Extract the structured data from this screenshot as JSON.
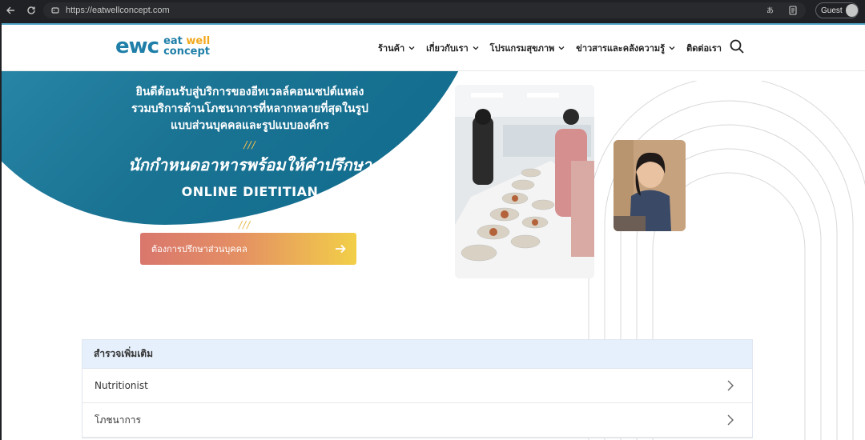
{
  "browser": {
    "url": "https://eatwellconcept.com",
    "profile_label": "Guest",
    "right_icon_1": "translate-icon",
    "right_icon_2": "reader-icon"
  },
  "header": {
    "logo_mark": "ewc",
    "logo_word_1": "eat",
    "logo_word_2": "well",
    "logo_word_3": "concept",
    "menu": [
      {
        "label": "ร้านค้า"
      },
      {
        "label": "เกี่ยวกับเรา"
      },
      {
        "label": "โปรแกรมสุขภาพ"
      },
      {
        "label": "ข่าวสารและคลังความรู้"
      },
      {
        "label": "ติดต่อเรา"
      }
    ]
  },
  "hero": {
    "line1": "ยินดีต้อนรับสู่บริการของอีทเวลล์คอนเซปต์แหล่ง",
    "line2": "รวมบริการด้านโภชนาการที่หลากหลายที่สุดในรูป",
    "line3": "แบบส่วนบุคคลและรูปแบบองค์กร",
    "slashes": "///",
    "big": "นักกำหนดอาหารพร้อมให้คำปรึกษา",
    "sub": "ONLINE DIETITIAN",
    "cta_label": "ต้องการปรึกษาส่วนบุคคล"
  },
  "explore": {
    "title": "สำรวจเพิ่มเติม",
    "rows": [
      {
        "label": "Nutritionist"
      },
      {
        "label": "โภชนาการ"
      }
    ]
  },
  "colors": {
    "brand_teal": "#1a7393",
    "brand_orange": "#f2a81d",
    "cta_start": "#d9776d",
    "cta_end": "#f2cf48"
  }
}
